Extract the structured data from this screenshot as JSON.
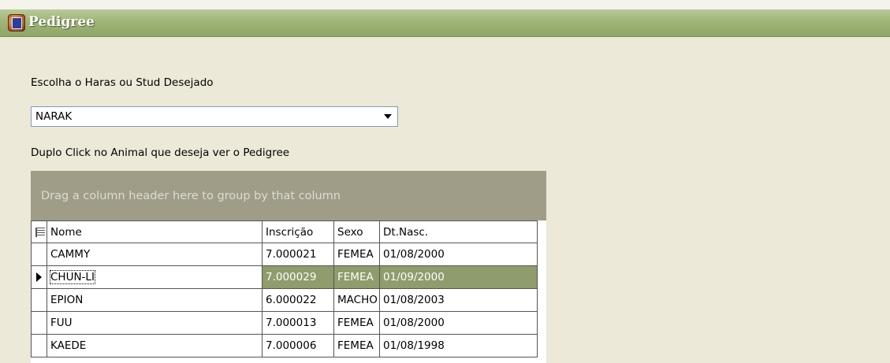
{
  "window": {
    "title": "Pedigree"
  },
  "form": {
    "haras_label": "Escolha o Haras ou Stud Desejado",
    "haras_value": "NARAK",
    "instruction": "Duplo Click no Animal que deseja ver o Pedigree"
  },
  "grid": {
    "group_hint": "Drag a column header here to group by that column",
    "columns": [
      "Nome",
      "Inscrição",
      "Sexo",
      "Dt.Nasc."
    ],
    "rows": [
      {
        "nome": "CAMMY",
        "inscricao": "7.000021",
        "sexo": "FEMEA",
        "dtnasc": "01/08/2000"
      },
      {
        "nome": "CHUN-LI",
        "inscricao": "7.000029",
        "sexo": "FEMEA",
        "dtnasc": "01/09/2000"
      },
      {
        "nome": "EPION",
        "inscricao": "6.000022",
        "sexo": "MACHO",
        "dtnasc": "01/08/2003"
      },
      {
        "nome": "FUU",
        "inscricao": "7.000013",
        "sexo": "FEMEA",
        "dtnasc": "01/08/2000"
      },
      {
        "nome": "KAEDE",
        "inscricao": "7.000006",
        "sexo": "FEMEA",
        "dtnasc": "01/08/1998"
      }
    ],
    "selected_row": 1
  },
  "colors": {
    "titlebar": "#9fb578",
    "selection": "#8f9c6c",
    "group_panel": "#9f9d88"
  }
}
